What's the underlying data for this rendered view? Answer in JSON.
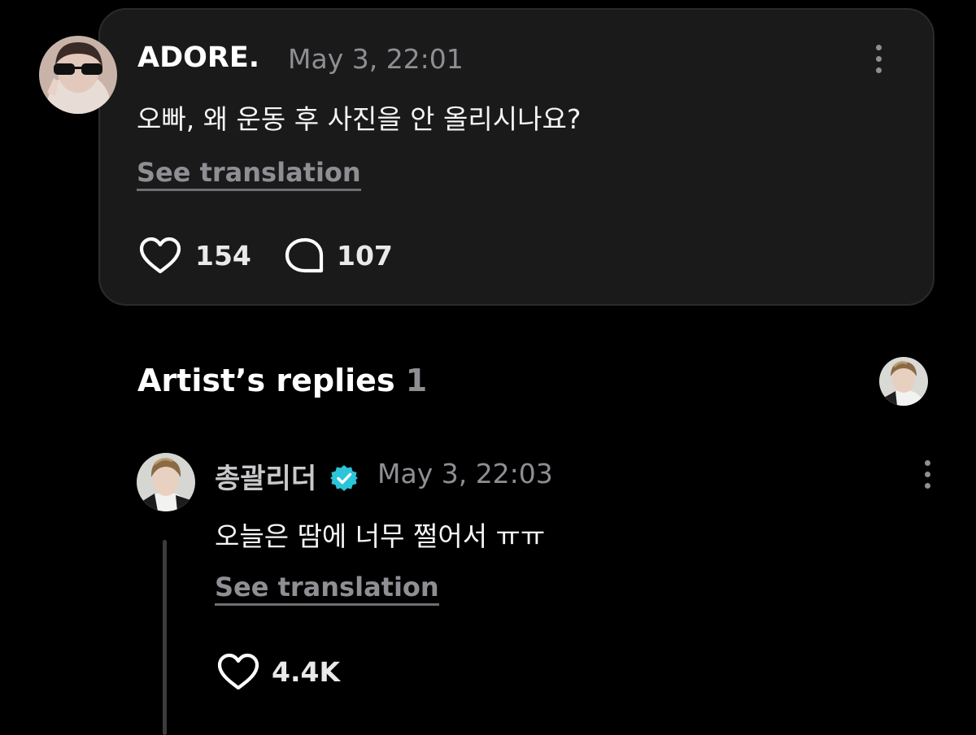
{
  "comment": {
    "author": "ADORE.",
    "timestamp": "May 3, 22:01",
    "text": "오빠, 왜 운동 후 사진을 안 올리시나요?",
    "see_translation": "See translation",
    "likes": "154",
    "replies": "107",
    "more_icon": "kebab-vertical-icon"
  },
  "artist_replies": {
    "title": "Artist’s replies",
    "count": "1"
  },
  "reply": {
    "author": "총괄리더",
    "verified_icon": "verified-badge-icon",
    "timestamp": "May 3, 22:03",
    "text": "오늘은 땀에 너무 쩔어서 ㅠㅠ",
    "see_translation": "See translation",
    "likes": "4.4K",
    "more_icon": "kebab-vertical-icon"
  },
  "colors": {
    "background": "#000000",
    "card": "#1a1a1b",
    "muted_text": "#8e8e93",
    "verified": "#2cc4d8"
  }
}
